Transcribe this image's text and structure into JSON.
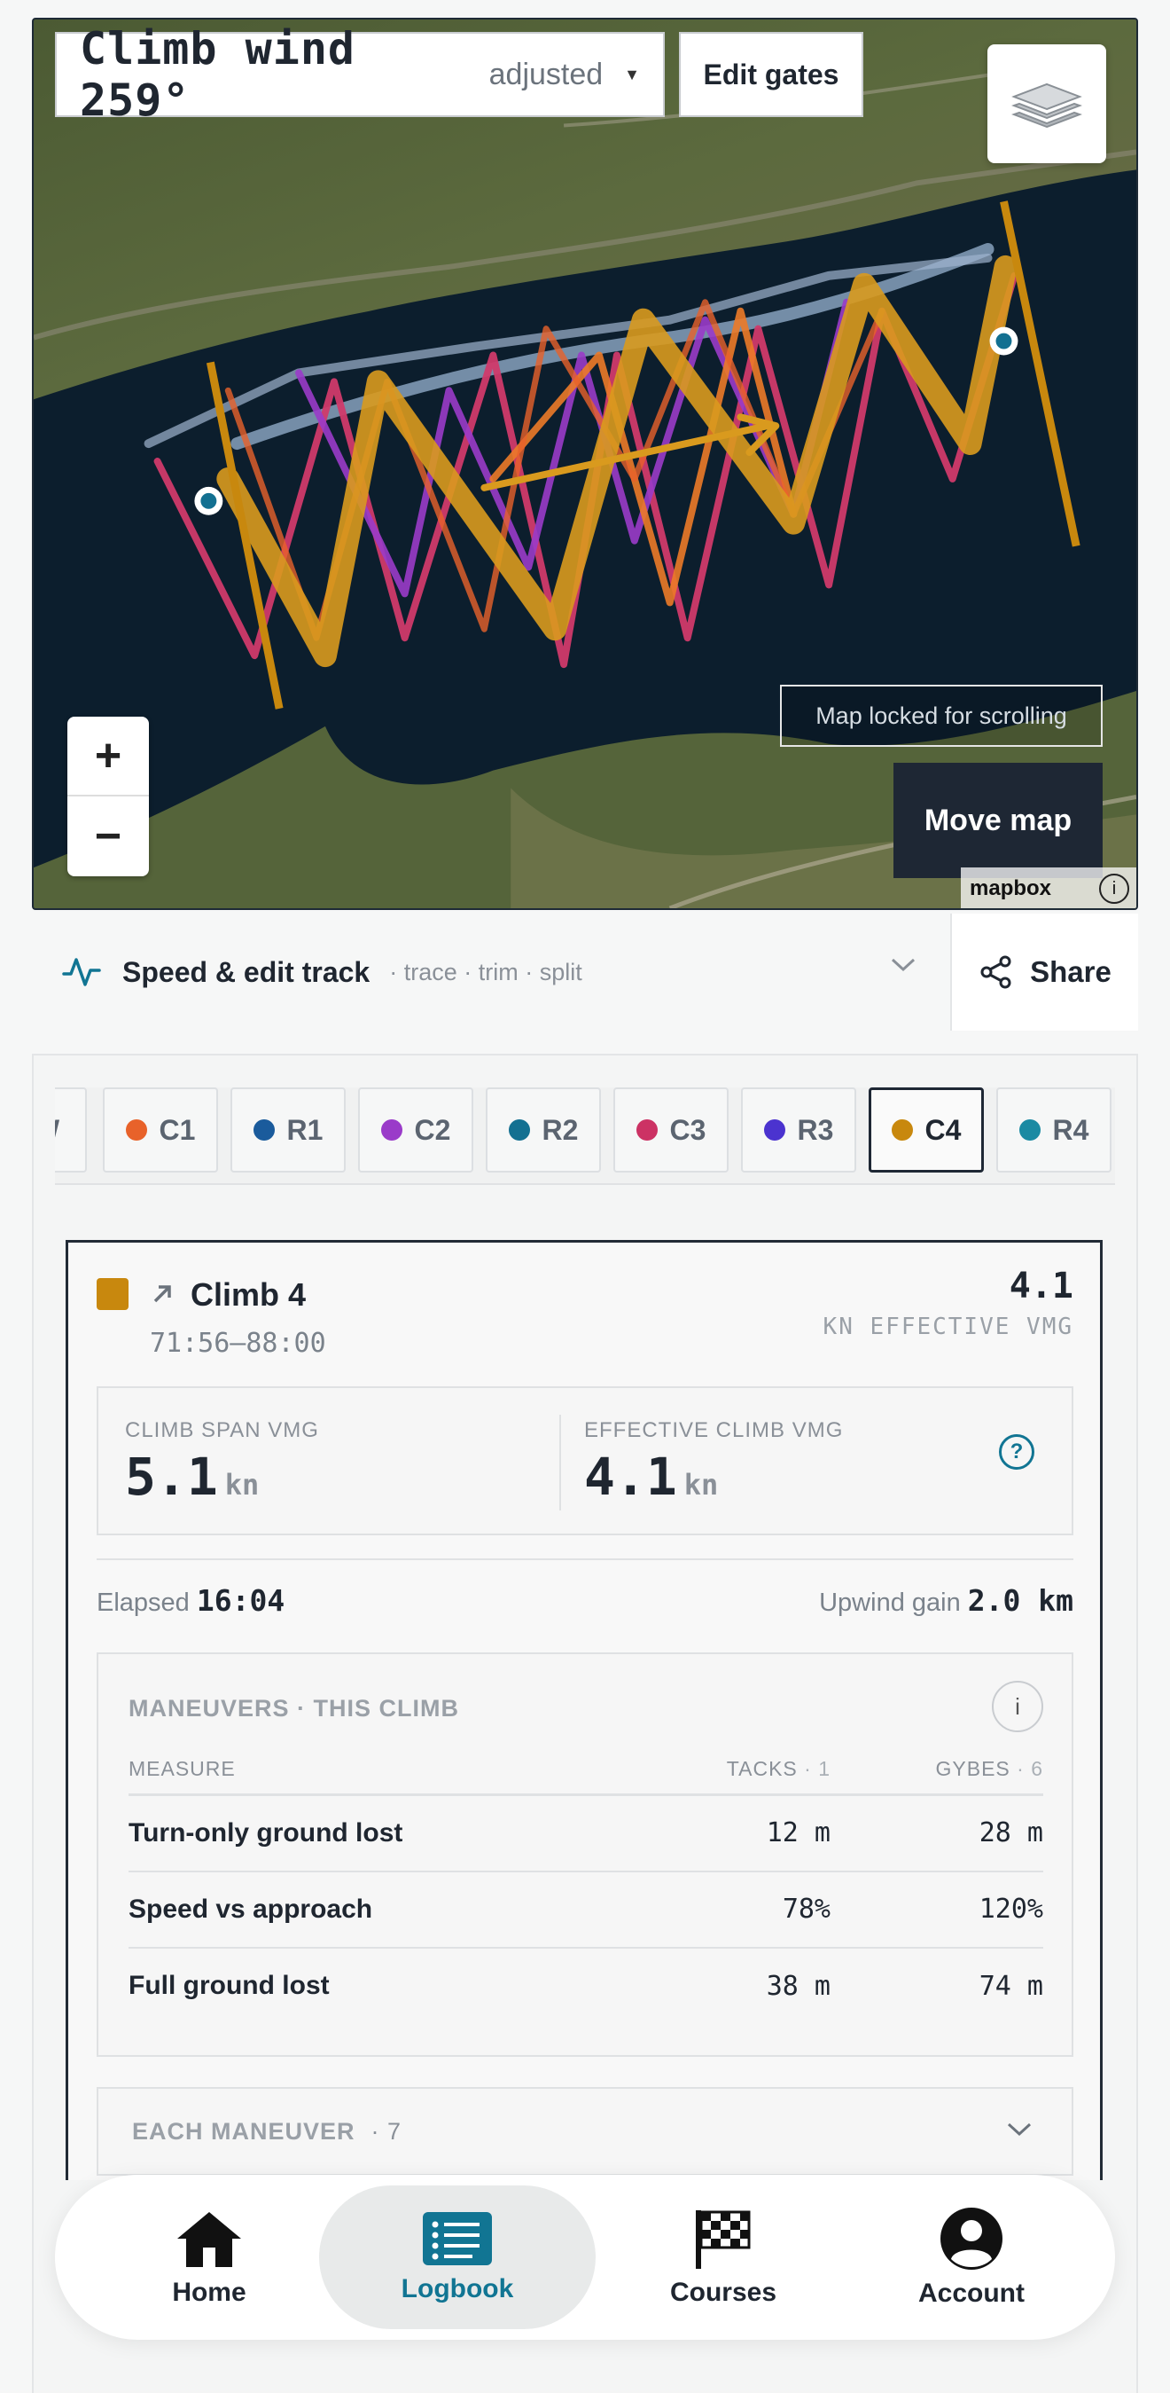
{
  "map": {
    "climb_title": "Climb wind 259°",
    "adjusted_label": "adjusted",
    "edit_gates_label": "Edit gates",
    "zoom_in_label": "+",
    "zoom_out_label": "−",
    "locked_label": "Map locked for scrolling",
    "move_map_label": "Move map",
    "attribution": "mapbox",
    "attribution_info": "i"
  },
  "speed_bar": {
    "label": "Speed & edit track",
    "sub": "· trace · trim · split",
    "share_label": "Share"
  },
  "chips": [
    {
      "label": "W",
      "color": "#ffffff",
      "active": false
    },
    {
      "label": "C1",
      "color": "#e8622a",
      "active": false
    },
    {
      "label": "R1",
      "color": "#1a5b9c",
      "active": false
    },
    {
      "label": "C2",
      "color": "#9a3bc9",
      "active": false
    },
    {
      "label": "R2",
      "color": "#137091",
      "active": false
    },
    {
      "label": "C3",
      "color": "#cc3264",
      "active": false
    },
    {
      "label": "R3",
      "color": "#4b33cf",
      "active": false
    },
    {
      "label": "C4",
      "color": "#c8880e",
      "active": true
    },
    {
      "label": "R4",
      "color": "#1a8aa3",
      "active": false
    }
  ],
  "climb": {
    "title": "Climb 4",
    "time_range": "71:56–88:00",
    "headline_value": "4.1",
    "headline_label": "KN EFFECTIVE VMG",
    "span_vmg_label": "CLIMB SPAN VMG",
    "span_vmg_value": "5.1",
    "span_vmg_unit": "kn",
    "effective_vmg_label": "EFFECTIVE CLIMB VMG",
    "effective_vmg_value": "4.1",
    "effective_vmg_unit": "kn",
    "help_label": "?",
    "elapsed_label": "Elapsed",
    "elapsed_value": "16:04",
    "gain_label": "Upwind gain",
    "gain_value": "2.0 km"
  },
  "maneuvers": {
    "heading": "MANEUVERS · THIS CLIMB",
    "info_label": "i",
    "col_measure": "MEASURE",
    "col_tacks": "TACKS",
    "tacks_count": "· 1",
    "col_gybes": "GYBES",
    "gybes_count": "· 6",
    "rows": [
      {
        "measure": "Turn-only ground lost",
        "tacks": "12 m",
        "gybes": "28 m"
      },
      {
        "measure": "Speed vs approach",
        "tacks": "78%",
        "gybes": "120%"
      },
      {
        "measure": "Full ground lost",
        "tacks": "38 m",
        "gybes": "74 m"
      }
    ],
    "each_label": "EACH MANEUVER",
    "each_count": "· 7"
  },
  "nav": {
    "items": [
      {
        "label": "Home",
        "icon": "home-icon"
      },
      {
        "label": "Logbook",
        "icon": "logbook-icon",
        "active": true
      },
      {
        "label": "Courses",
        "icon": "checkered-flag-icon"
      },
      {
        "label": "Account",
        "icon": "account-icon"
      }
    ]
  }
}
